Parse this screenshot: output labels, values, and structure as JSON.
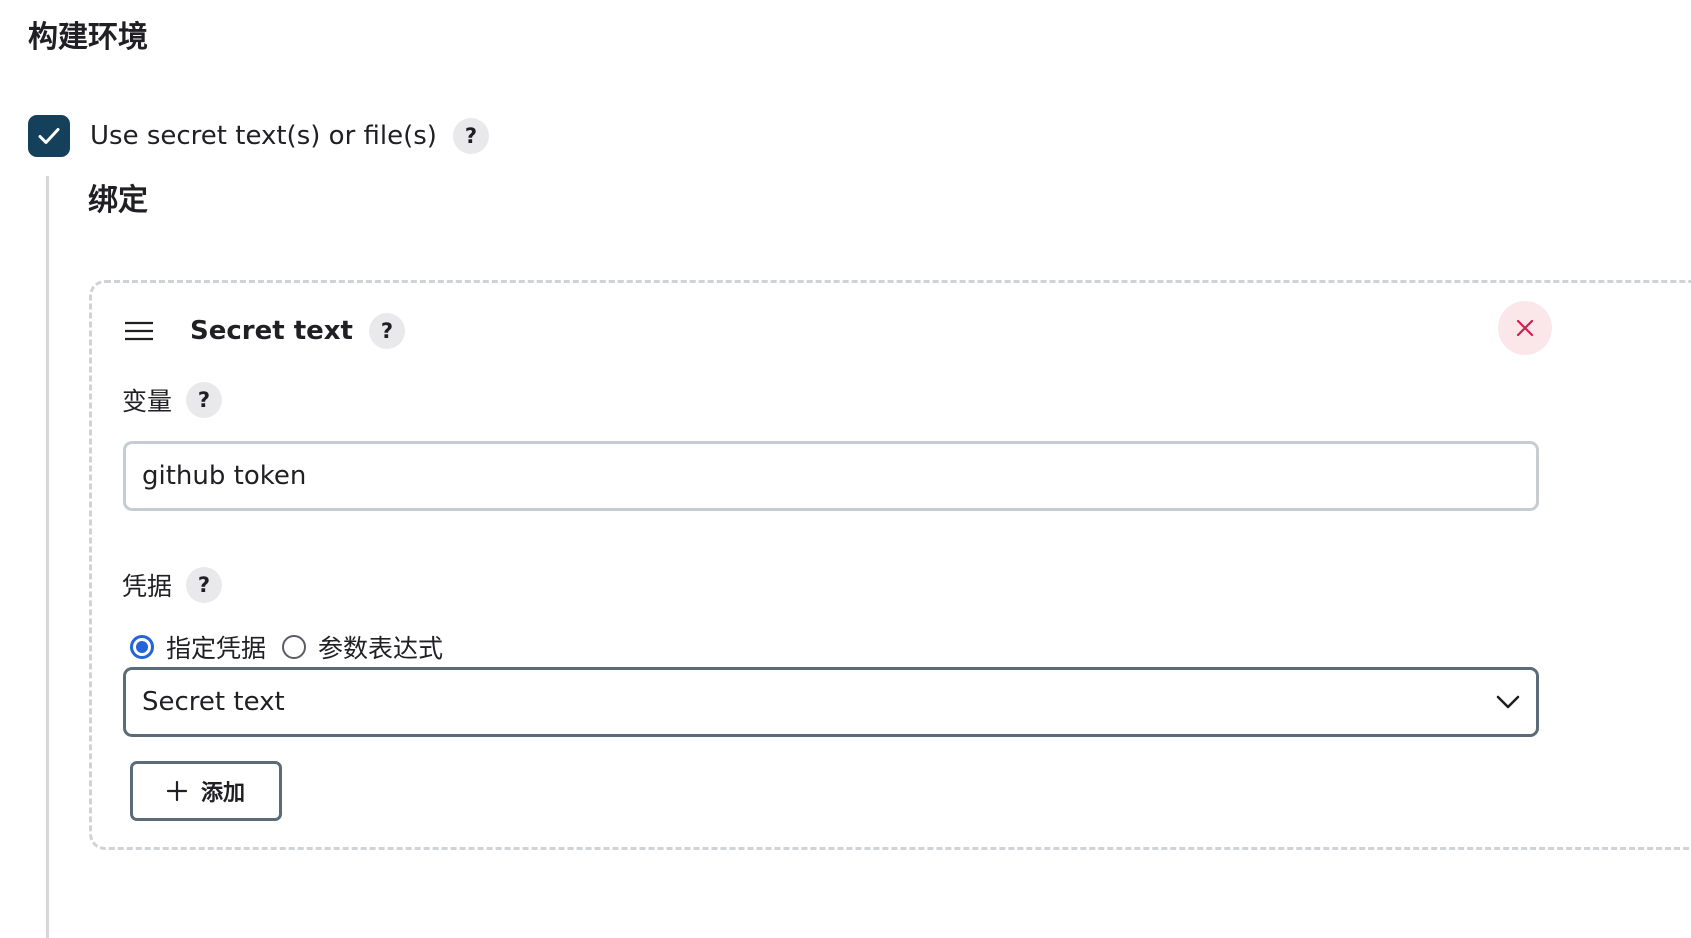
{
  "section": {
    "title": "构建环境"
  },
  "secret_option": {
    "label": "Use secret text(s) or file(s)",
    "checked": true,
    "help_glyph": "?"
  },
  "bindings": {
    "title": "绑定",
    "card": {
      "title": "Secret text",
      "help_glyph": "?",
      "variable": {
        "label": "变量",
        "help_glyph": "?",
        "value": "github token"
      },
      "credentials": {
        "label": "凭据",
        "help_glyph": "?",
        "radio_options": [
          {
            "label": "指定凭据",
            "selected": true
          },
          {
            "label": "参数表达式",
            "selected": false
          }
        ],
        "selected_credential": "Secret text",
        "add_button_label": "添加"
      }
    }
  },
  "colors": {
    "checkbox": "#14405c",
    "radio_selected": "#2563d9",
    "close_icon": "#d1214a",
    "close_bg": "#fbe7ea",
    "dashed_border": "#cfd2d6"
  }
}
